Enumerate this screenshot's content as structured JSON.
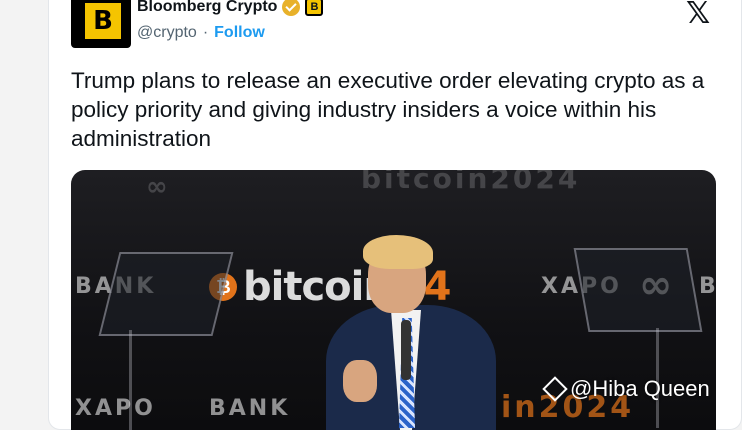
{
  "account": {
    "avatar_letter": "B",
    "name": "Bloomberg Crypto",
    "affiliate_badge": "B",
    "handle": "@crypto",
    "separator": "·",
    "follow_label": "Follow",
    "verified_color": "#e8b12a",
    "brand_color": "#f5c400"
  },
  "platform_logo": "𝕏",
  "tweet": {
    "text": "Trump plans to release an executive order elevating crypto as a policy priority and giving industry insiders a voice within his administration"
  },
  "photo": {
    "backdrop": {
      "xapo_left": "BANK",
      "xapo_right_brand": "XAPO",
      "xapo_right_tail": "B",
      "bitcoin_word": "bitcoin",
      "bitcoin_year": "24",
      "bottom_left": "XAPO",
      "bottom_bank": "BANK",
      "bottom_year": "in2024",
      "top_text": "bitcoin2024"
    },
    "watermark": "@Hiba Queen"
  },
  "icons": {
    "verified": "verified-check-icon",
    "affiliate": "affiliate-badge-icon",
    "platform": "x-logo-icon",
    "watermark": "binance-diamond-icon"
  }
}
